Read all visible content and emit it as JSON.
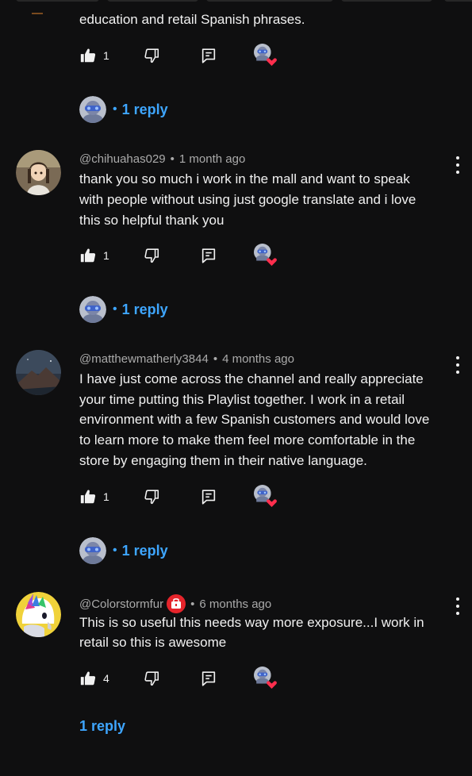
{
  "comments": [
    {
      "id": "c0",
      "lines": [
        "education and retail Spanish phrases."
      ],
      "likes": "1",
      "replies": "1 reply",
      "reply_separator": "•"
    },
    {
      "id": "c1",
      "handle": "@chihuahas029",
      "time": "1 month ago",
      "meta_separator": "•",
      "lines": [
        "thank you so much i work in the mall and want to speak",
        "with people without using just google translate and i love",
        "this so helpful thank you"
      ],
      "likes": "1",
      "replies": "1 reply",
      "reply_separator": "•"
    },
    {
      "id": "c2",
      "handle": "@matthewmatherly3844",
      "time": "4 months ago",
      "meta_separator": "•",
      "lines": [
        "I have just come across the channel and really appreciate",
        "your time putting this Playlist together. I work in a retail",
        "environment with a few Spanish customers and would love",
        "to learn more to make them feel more comfortable in the",
        "store by engaging them in their native language."
      ],
      "likes": "1",
      "replies": "1 reply",
      "reply_separator": "•"
    },
    {
      "id": "c3",
      "handle": "@Colorstormfur",
      "time": "6 months ago",
      "meta_separator": "•",
      "lines": [
        "This is so useful this needs way more exposure...I work in",
        "retail so this is awesome"
      ],
      "likes": "4",
      "replies": "1 reply"
    }
  ],
  "colors": {
    "background": "#0f0f10",
    "link": "#3ea6ff",
    "heart": "#ff2e4d",
    "meta": "#aaaaaa"
  },
  "icons": [
    "thumbs-up-icon",
    "thumbs-down-icon",
    "reply-comment-icon",
    "creator-heart-icon",
    "more-vert-icon",
    "member-badge-icon"
  ]
}
